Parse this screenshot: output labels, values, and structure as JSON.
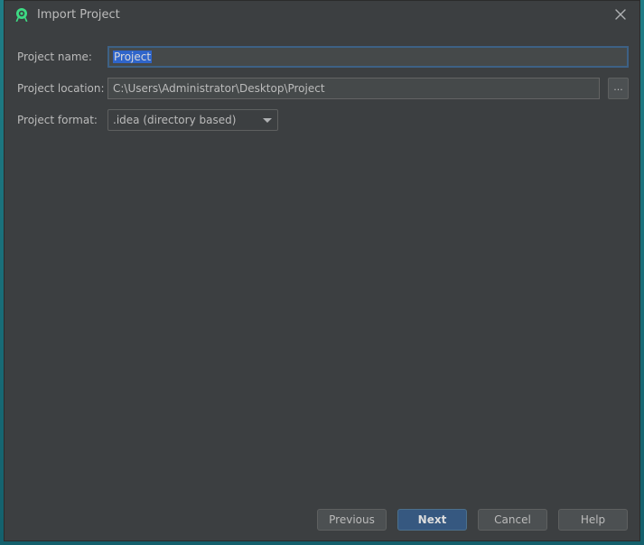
{
  "window": {
    "title": "Import Project",
    "app_icon": "android-studio-icon",
    "close_icon": "close-icon"
  },
  "form": {
    "name_label": "Project name:",
    "name_value": "Project",
    "location_label": "Project location:",
    "location_value": "C:\\Users\\Administrator\\Desktop\\Project",
    "browse_label": "...",
    "format_label": "Project format:",
    "format_value": ".idea (directory based)"
  },
  "buttons": {
    "previous": "Previous",
    "next": "Next",
    "cancel": "Cancel",
    "help": "Help"
  },
  "colors": {
    "dialog_bg": "#3c3f41",
    "focus_border": "#3d6185",
    "selection": "#2f65ca",
    "default_button": "#365880"
  }
}
